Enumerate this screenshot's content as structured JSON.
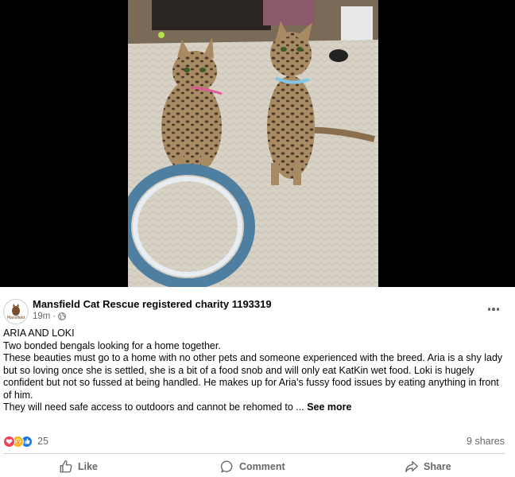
{
  "photo": {
    "alt_icons": [
      "cat-aria",
      "cat-loki",
      "circular-cat-toy",
      "rug"
    ]
  },
  "post": {
    "page_name": "Mansfield Cat Rescue registered charity 1193319",
    "avatar_text": "Mansfield",
    "time": "19m",
    "time_separator": "·",
    "audience_icon": "globe-icon",
    "more_icon": "ellipsis-icon",
    "title_line": "ARIA AND LOKI",
    "line_1": "Two bonded bengals looking for a home together.",
    "line_2": "These beauties must go to a home with no other pets and someone experienced with the breed. Aria is a shy lady but so loving once she is settled, she is a bit of a food snob and will only eat KatKin wet food. Loki is hugely confident but not so fussed at being handled. He makes up for Aria’s fussy food issues by eating anything in front of him.",
    "line_3": "They will need safe access to outdoors and cannot be rehomed to ...",
    "see_more": "See more"
  },
  "engagement": {
    "reaction_icons": [
      "love-reaction-icon",
      "care-reaction-icon",
      "like-reaction-icon"
    ],
    "reaction_count": "25",
    "shares": "9 shares"
  },
  "actions": {
    "like": "Like",
    "comment": "Comment",
    "share": "Share"
  },
  "colors": {
    "text_primary": "#050505",
    "text_secondary": "#65676b",
    "like_blue": "#1877f2",
    "love_red": "#f33e58",
    "care_yellow": "#f7b125",
    "divider": "#ced0d4"
  }
}
